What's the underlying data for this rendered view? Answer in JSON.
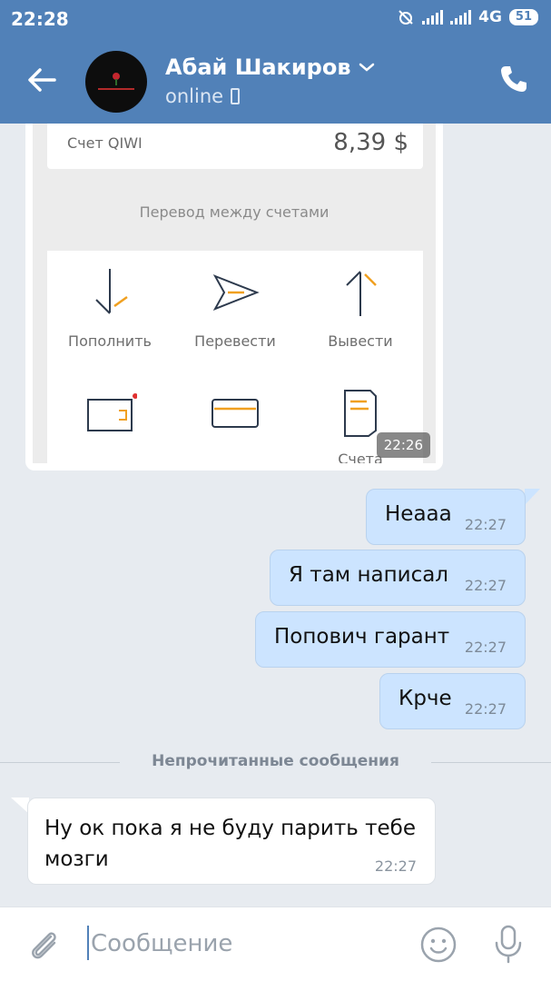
{
  "status_bar": {
    "time": "22:28",
    "network": "4G",
    "battery": "51"
  },
  "header": {
    "contact_name": "Абай Шакиров",
    "presence": "online"
  },
  "image_message": {
    "account_label": "Счет QIWI",
    "account_value": "8,39 $",
    "transfer_title": "Перевод между счетами",
    "actions": [
      {
        "label": "Пополнить",
        "icon": "arrow-down-icon"
      },
      {
        "label": "Перевести",
        "icon": "send-arrow-icon"
      },
      {
        "label": "Вывести",
        "icon": "arrow-up-icon"
      },
      {
        "label": "",
        "icon": "wallet-card-icon"
      },
      {
        "label": "",
        "icon": "card-icon"
      },
      {
        "label": "Счета",
        "icon": "invoice-icon"
      }
    ],
    "time": "22:26"
  },
  "outgoing": [
    {
      "text": "Неааа",
      "time": "22:27"
    },
    {
      "text": "Я там написал",
      "time": "22:27"
    },
    {
      "text": "Попович гарант",
      "time": "22:27"
    },
    {
      "text": "Крче",
      "time": "22:27"
    }
  ],
  "divider": {
    "label": "Непрочитанные сообщения"
  },
  "incoming": {
    "text": "Ну ок пока я не буду парить тебе мозги",
    "time": "22:27"
  },
  "composer": {
    "placeholder": "Сообщение"
  },
  "colors": {
    "header": "#5181b8",
    "outgoing_bubble": "#cce4ff",
    "background": "#e7ebf0"
  }
}
